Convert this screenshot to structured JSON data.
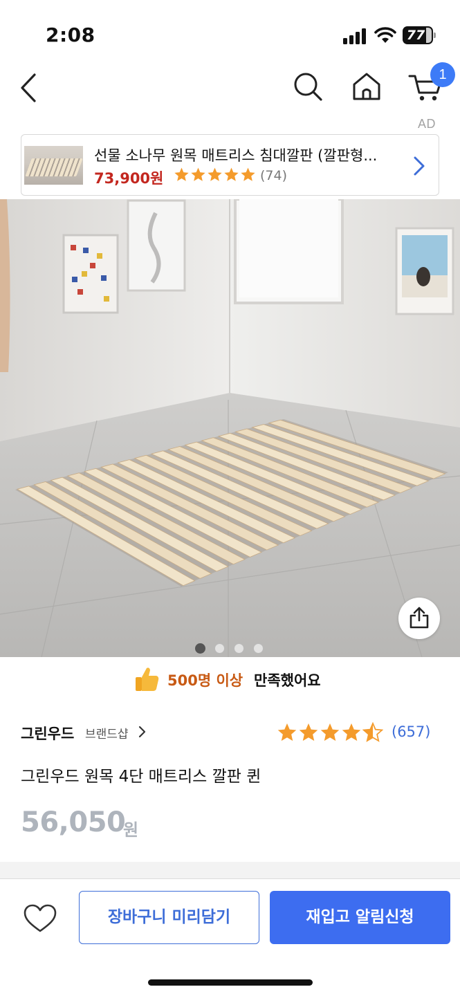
{
  "status_bar": {
    "time": "2:08",
    "battery": "77"
  },
  "nav": {
    "icons": [
      "back-icon",
      "search-icon",
      "home-icon",
      "cart-icon"
    ],
    "cart_badge": "1"
  },
  "ad": {
    "label": "AD",
    "title": "선물 소나무 원목 매트리스 침대깔판 (깔판형...",
    "price": "73,900원",
    "rating_stars": 5,
    "review_count": "(74)"
  },
  "gallery": {
    "slide_count": 4,
    "active_index": 0
  },
  "satisfaction": {
    "highlight": "500명 이상",
    "rest": "만족했어요"
  },
  "product": {
    "brand": "그린우드",
    "brand_shop": "브랜드샵",
    "rating": 4.5,
    "review_count": "(657)",
    "title": "그린우드 원목 4단 매트리스 깔판 퀸",
    "price": "56,050",
    "price_unit": "원"
  },
  "actions": {
    "cart_add": "장바구니 미리담기",
    "restock": "재입고 알림신청"
  },
  "colors": {
    "accent_blue": "#3d6df0",
    "price_red": "#c3271f",
    "star_orange": "#f49b2c",
    "highlight_orange": "#c85a14"
  }
}
